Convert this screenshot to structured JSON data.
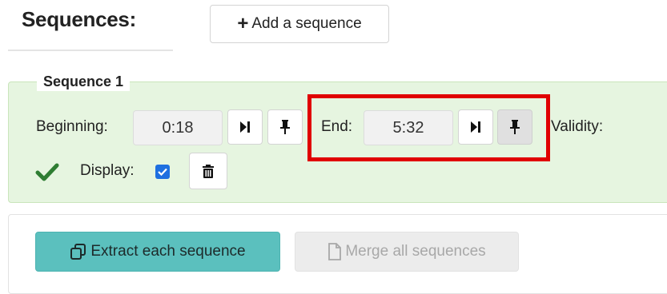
{
  "header": {
    "title": "Sequences:",
    "add_button_label": "Add a sequence"
  },
  "sequence": {
    "legend": "Sequence 1",
    "beginning_label": "Beginning:",
    "beginning_value": "0:18",
    "end_label": "End:",
    "end_value": "5:32",
    "validity_label": "Validity:",
    "display_label": "Display:",
    "display_checked": true
  },
  "actions": {
    "extract_label": "Extract each sequence",
    "merge_label": "Merge all sequences"
  },
  "colors": {
    "panel_bg": "#e6f5e0",
    "extract_bg": "#5bc0be",
    "highlight": "#e00000",
    "checkbox": "#1e6fe0",
    "valid_check": "#2e7d32"
  },
  "icons": {
    "add": "plus-icon",
    "jump_to_time": "skip-to-end-icon",
    "set_current_time": "pushpin-icon",
    "valid": "check-icon",
    "delete": "trash-icon",
    "extract": "copy-icon",
    "merge": "file-icon"
  }
}
